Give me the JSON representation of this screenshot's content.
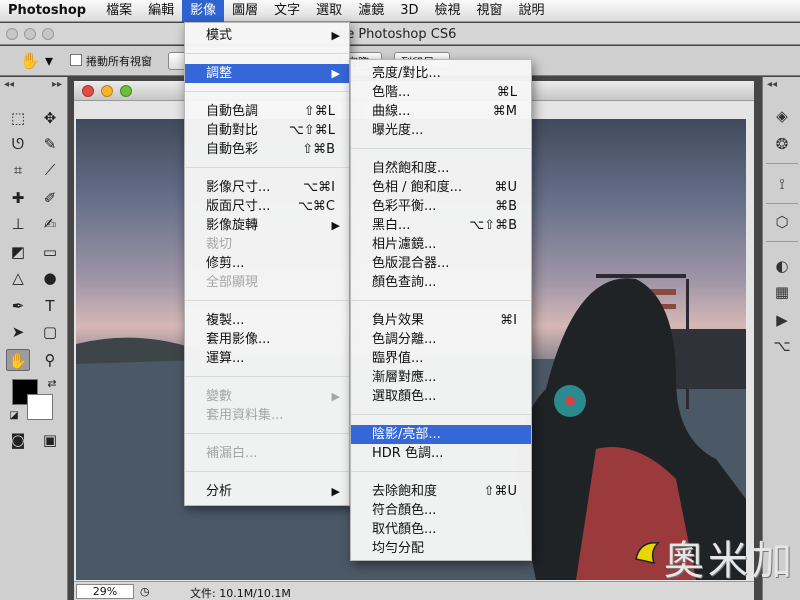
{
  "menubar": {
    "app_name": "Photoshop",
    "items": [
      "檔案",
      "編輯",
      "影像",
      "圖層",
      "文字",
      "選取",
      "濾鏡",
      "3D",
      "檢視",
      "視窗",
      "說明"
    ]
  },
  "window": {
    "title": "obe Photoshop CS6"
  },
  "options_bar": {
    "scroll_all_windows": "捲動所有視窗",
    "btn_1": "實際",
    "btn_2": "列印尺寸"
  },
  "image_menu": {
    "items": [
      {
        "label": "模式",
        "submenu": true
      },
      {
        "label": "調整",
        "submenu": true,
        "highlighted": true
      },
      {
        "label": "自動色調",
        "shortcut": "⇧⌘L"
      },
      {
        "label": "自動對比",
        "shortcut": "⌥⇧⌘L"
      },
      {
        "label": "自動色彩",
        "shortcut": "⇧⌘B"
      },
      {
        "label": "影像尺寸...",
        "shortcut": "⌥⌘I"
      },
      {
        "label": "版面尺寸...",
        "shortcut": "⌥⌘C"
      },
      {
        "label": "影像旋轉",
        "submenu": true
      },
      {
        "label": "裁切",
        "disabled": true
      },
      {
        "label": "修剪..."
      },
      {
        "label": "全部顯現",
        "disabled": true
      },
      {
        "label": "複製..."
      },
      {
        "label": "套用影像..."
      },
      {
        "label": "運算..."
      },
      {
        "label": "變數",
        "submenu": true,
        "disabled": true
      },
      {
        "label": "套用資料集...",
        "disabled": true
      },
      {
        "label": "補漏白...",
        "disabled": true
      },
      {
        "label": "分析",
        "submenu": true
      }
    ]
  },
  "adjust_menu": {
    "items": [
      {
        "label": "亮度/對比..."
      },
      {
        "label": "色階...",
        "shortcut": "⌘L"
      },
      {
        "label": "曲線...",
        "shortcut": "⌘M"
      },
      {
        "label": "曝光度..."
      },
      {
        "label": "自然飽和度..."
      },
      {
        "label": "色相 / 飽和度...",
        "shortcut": "⌘U"
      },
      {
        "label": "色彩平衡...",
        "shortcut": "⌘B"
      },
      {
        "label": "黑白...",
        "shortcut": "⌥⇧⌘B"
      },
      {
        "label": "相片濾鏡..."
      },
      {
        "label": "色版混合器..."
      },
      {
        "label": "顏色查詢..."
      },
      {
        "label": "負片效果",
        "shortcut": "⌘I"
      },
      {
        "label": "色調分離..."
      },
      {
        "label": "臨界值..."
      },
      {
        "label": "漸層對應..."
      },
      {
        "label": "選取顏色..."
      },
      {
        "label": "陰影/亮部...",
        "highlighted": true
      },
      {
        "label": "HDR 色調..."
      },
      {
        "label": "去除飽和度",
        "shortcut": "⇧⌘U"
      },
      {
        "label": "符合顏色..."
      },
      {
        "label": "取代顏色..."
      },
      {
        "label": "均勻分配"
      }
    ]
  },
  "status": {
    "zoom": "29%",
    "doc_size": "文件: 10.1M/10.1M"
  },
  "watermark": {
    "text": "奧米加"
  },
  "colors": {
    "menu_highlight": "#3667d8",
    "foreground": "#000000",
    "background": "#ffffff"
  }
}
